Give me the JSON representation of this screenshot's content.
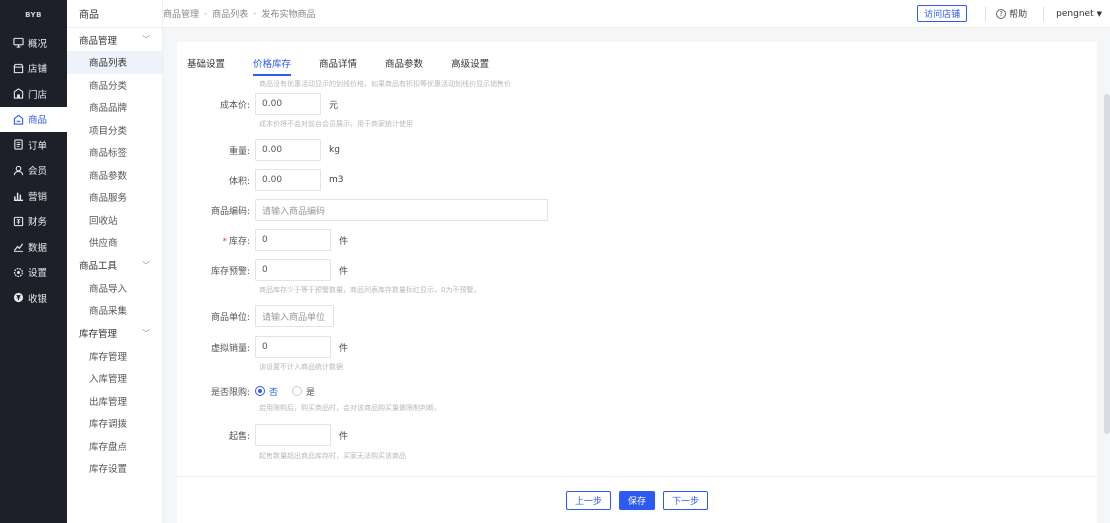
{
  "app": {
    "logo": "BYB"
  },
  "nav": [
    {
      "label": "概况",
      "icon": "monitor-icon"
    },
    {
      "label": "店铺",
      "icon": "store-icon"
    },
    {
      "label": "门店",
      "icon": "shop-icon"
    },
    {
      "label": "商品",
      "icon": "goods-icon"
    },
    {
      "label": "订单",
      "icon": "order-icon"
    },
    {
      "label": "会员",
      "icon": "member-icon"
    },
    {
      "label": "营销",
      "icon": "chart-icon"
    },
    {
      "label": "财务",
      "icon": "finance-icon"
    },
    {
      "label": "数据",
      "icon": "data-icon"
    },
    {
      "label": "设置",
      "icon": "settings-icon"
    },
    {
      "label": "收银",
      "icon": "cashier-icon"
    }
  ],
  "submenu": {
    "title": "商品",
    "groups": [
      {
        "label": "商品管理",
        "items": [
          "商品列表",
          "商品分类",
          "商品品牌",
          "项目分类",
          "商品标签",
          "商品参数",
          "商品服务",
          "回收站",
          "供应商"
        ]
      },
      {
        "label": "商品工具",
        "items": [
          "商品导入",
          "商品采集"
        ]
      },
      {
        "label": "库存管理",
        "items": [
          "库存管理",
          "入库管理",
          "出库管理",
          "库存调拨",
          "库存盘点",
          "库存设置"
        ]
      }
    ]
  },
  "breadcrumb": [
    "商品管理",
    "商品列表",
    "发布实物商品"
  ],
  "header": {
    "visit_store": "访问店铺",
    "help": "帮助",
    "user": "pengnet"
  },
  "tabs": [
    "基础设置",
    "价格库存",
    "商品详情",
    "商品参数",
    "高级设置"
  ],
  "form": {
    "hint_top": "商品没有优惠活动显示的划线价格，如果商品有折扣等优惠活动划线价显示销售价",
    "cost_price": {
      "label": "成本价:",
      "value": "0.00",
      "unit": "元",
      "hint": "成本价将不会对前台会员展示，用于商家统计使用"
    },
    "weight": {
      "label": "重量:",
      "value": "0.00",
      "unit": "kg"
    },
    "volume": {
      "label": "体积:",
      "value": "0.00",
      "unit": "m3"
    },
    "sku_code": {
      "label": "商品编码:",
      "placeholder": "请输入商品编码"
    },
    "stock": {
      "label": "库存:",
      "value": "0",
      "unit": "件"
    },
    "stock_alert": {
      "label": "库存预警:",
      "value": "0",
      "unit": "件",
      "hint": "商品库存少于等于预警数量，商品列表库存数量标红显示，0为不预警。"
    },
    "unit": {
      "label": "商品单位:",
      "placeholder": "请输入商品单位"
    },
    "virtual_sales": {
      "label": "虚拟销量:",
      "value": "0",
      "unit": "件",
      "hint": "该设置不计入商品统计数据"
    },
    "limit_purchase": {
      "label": "是否限购:",
      "options": [
        "否",
        "是"
      ],
      "selected": "否",
      "hint": "启用限购后，购买商品时，会对该商品购买量做限制判断。"
    },
    "min_buy": {
      "label": "起售:",
      "value": "",
      "unit": "件",
      "hint": "起售数量超出商品库存时，买家无法购买该商品"
    }
  },
  "footer": {
    "prev": "上一步",
    "save": "保存",
    "next": "下一步"
  },
  "colors": {
    "accent": "#2d5af0",
    "sidebar_bg": "#1d2028"
  }
}
